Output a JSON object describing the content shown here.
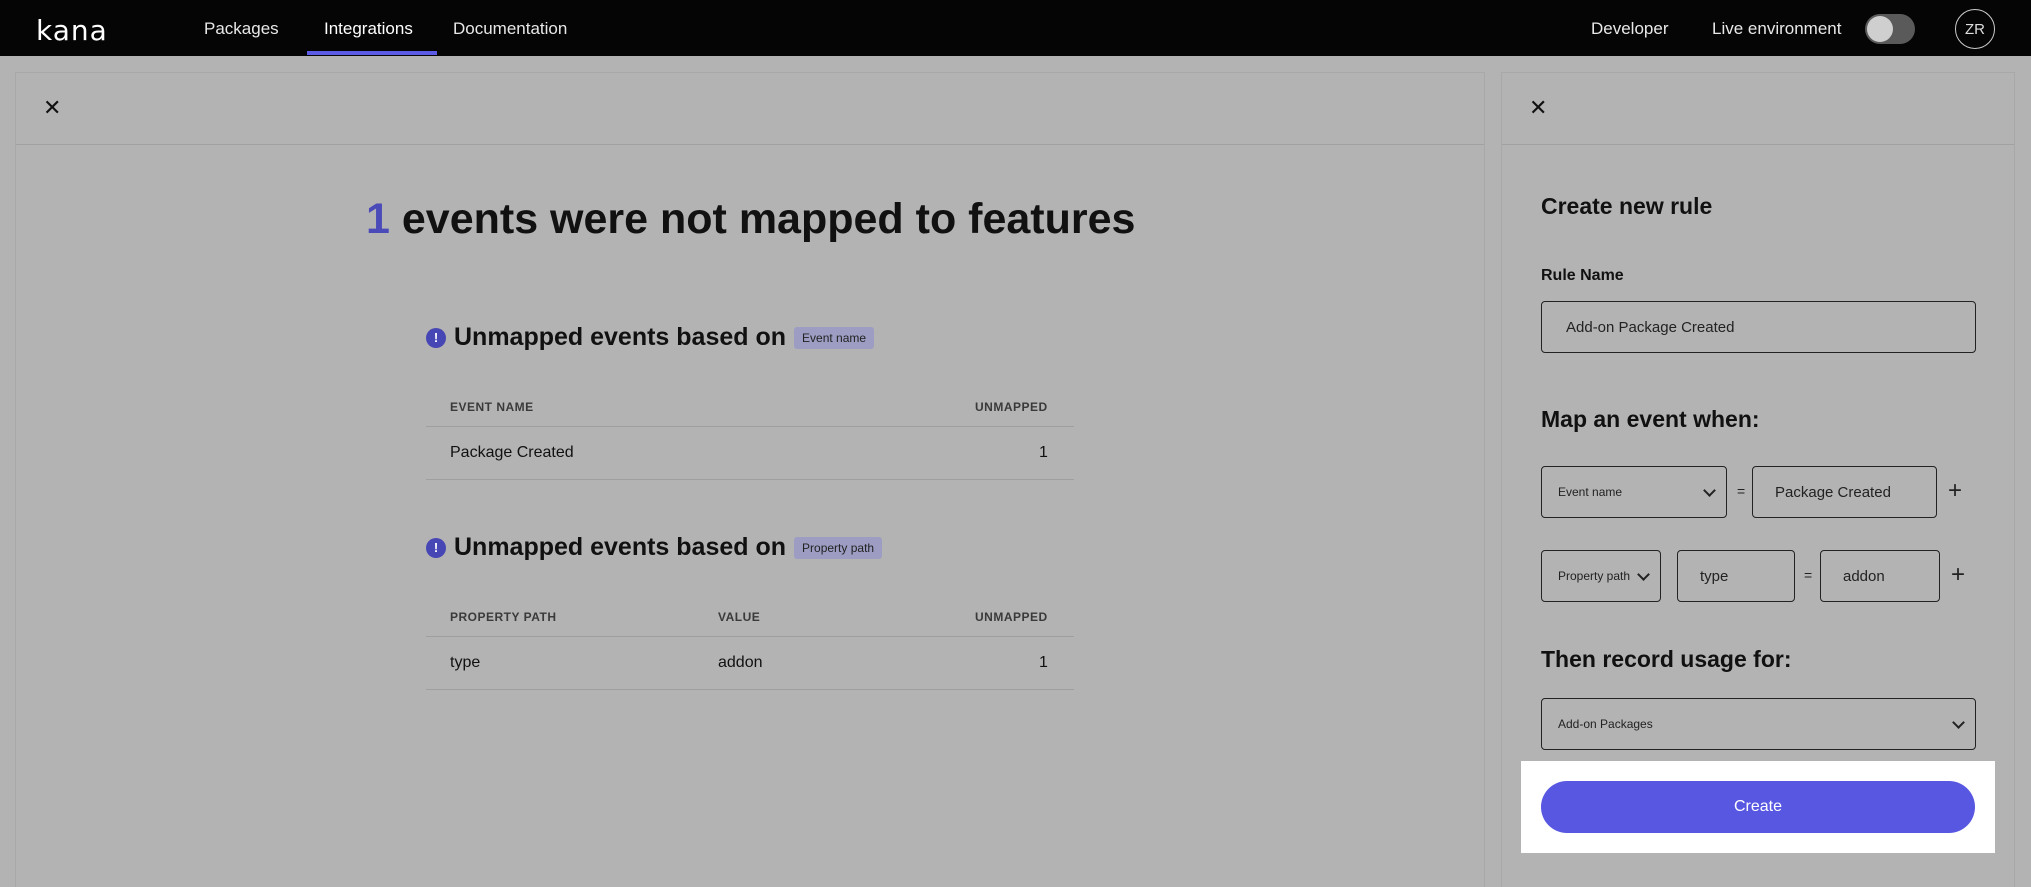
{
  "nav": {
    "logo": "kana",
    "items": [
      "Packages",
      "Integrations",
      "Documentation"
    ],
    "active_index": 1,
    "developer": "Developer",
    "live_env_label": "Live environment",
    "live_env_on": false,
    "avatar_initials": "ZR"
  },
  "left": {
    "unmapped_count": "1",
    "title_rest": " events were not mapped to features",
    "info_glyph": "!",
    "section_prefix": "Unmapped events based on",
    "event_section": {
      "badge": "Event name",
      "headers": [
        "EVENT NAME",
        "UNMAPPED"
      ],
      "rows": [
        {
          "event_name": "Package Created",
          "unmapped": "1"
        }
      ]
    },
    "property_section": {
      "badge": "Property path",
      "headers": [
        "PROPERTY PATH",
        "VALUE",
        "UNMAPPED"
      ],
      "rows": [
        {
          "property_path": "type",
          "value": "addon",
          "unmapped": "1"
        }
      ]
    }
  },
  "right": {
    "title": "Create new rule",
    "rule_name_label": "Rule Name",
    "rule_name_value": "Add-on Package Created",
    "map_heading": "Map an event when:",
    "condition1": {
      "field": "Event name",
      "value": "Package Created"
    },
    "condition2": {
      "field": "Property path",
      "key": "type",
      "value": "addon"
    },
    "equals": "=",
    "record_heading": "Then record usage for:",
    "feature_select": "Add-on Packages",
    "create_label": "Create"
  },
  "colors": {
    "accent": "#5757e2",
    "nav_bg": "#050505",
    "info": "#4646b5"
  }
}
